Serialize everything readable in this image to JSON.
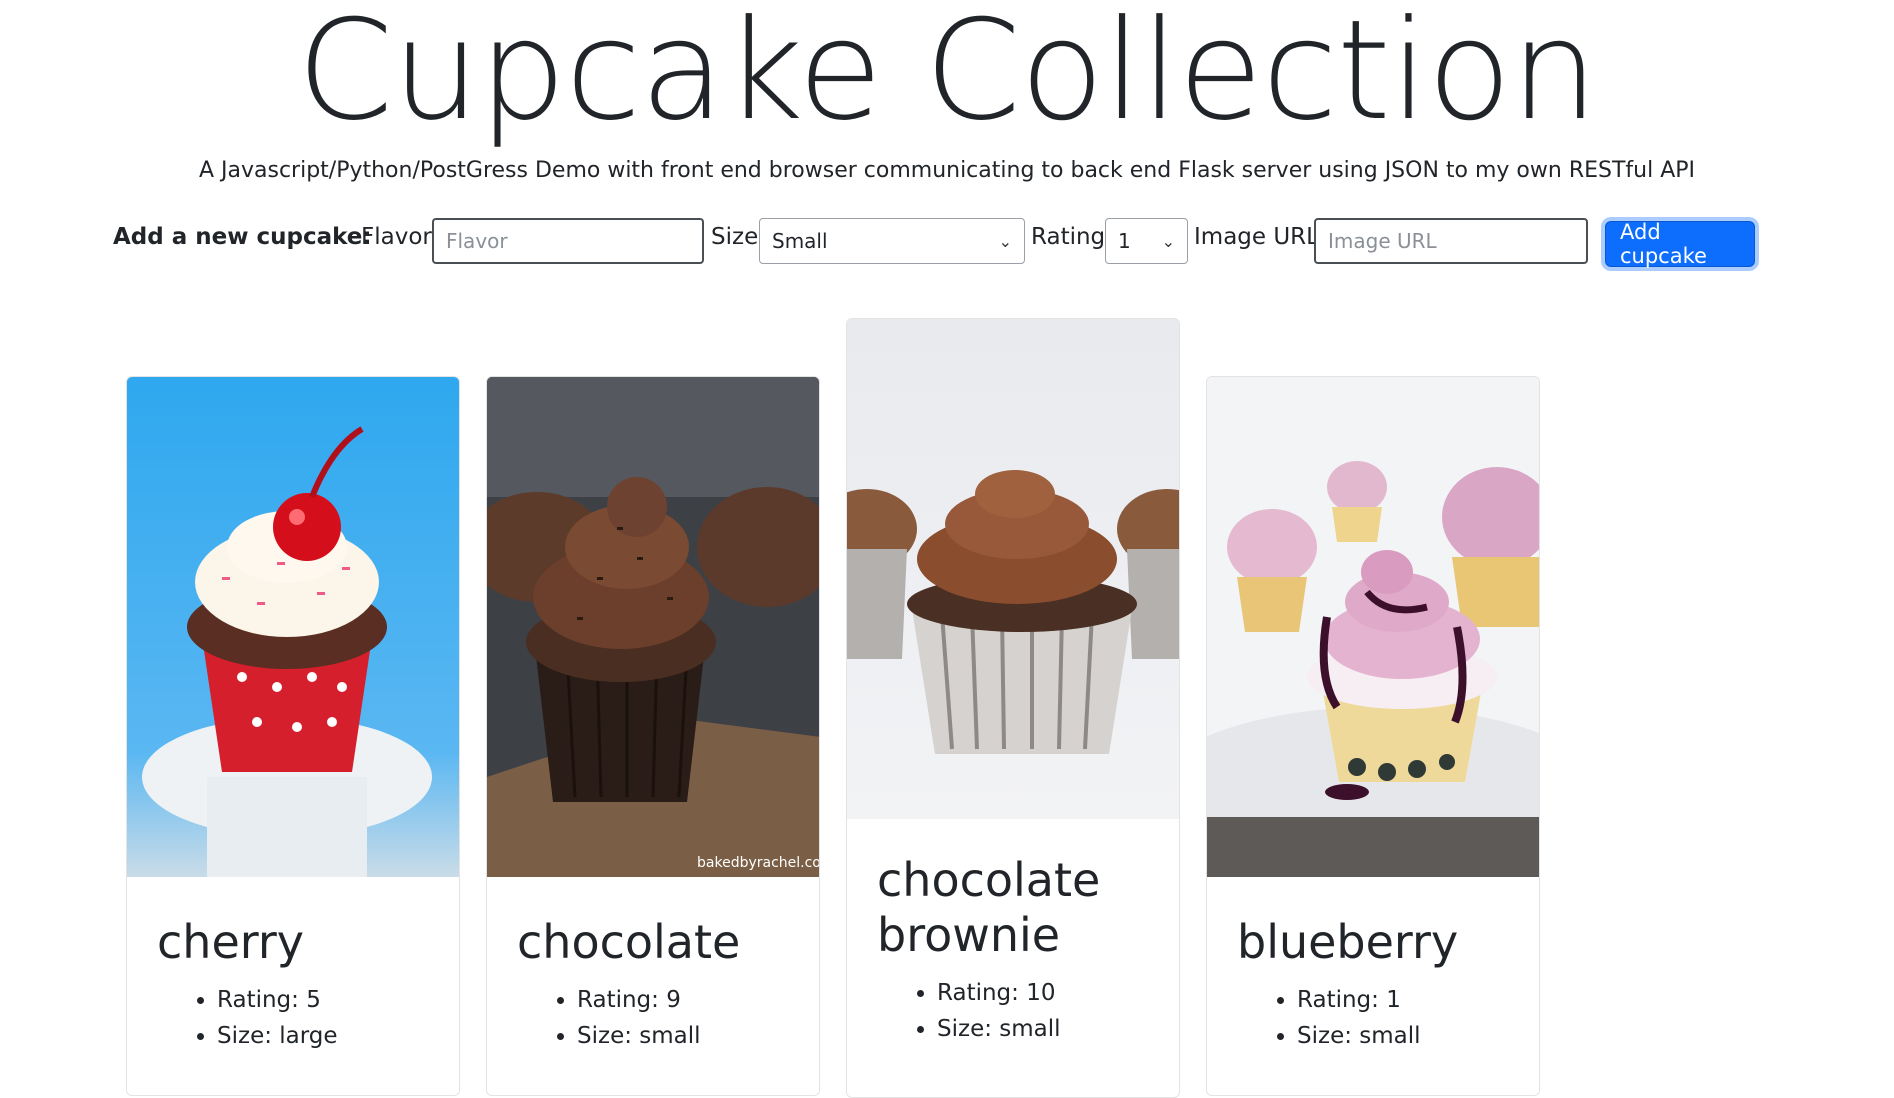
{
  "header": {
    "title": "Cupcake Collection",
    "subtitle": "A Javascript/Python/PostGress Demo with front end browser communicating to back end Flask server using JSON to my own RESTful API"
  },
  "form": {
    "heading": "Add a new cupcake:",
    "flavor_label": "Flavor",
    "flavor_placeholder": "Flavor",
    "size_label": "Size",
    "size_value": "Small",
    "rating_label": "Rating",
    "rating_value": "1",
    "image_label": "Image URL",
    "image_placeholder": "Image URL",
    "submit_label": "Add cupcake"
  },
  "cupcakes": [
    {
      "flavor": "cherry",
      "rating": "Rating: 5",
      "size": "Size: large"
    },
    {
      "flavor": "chocolate",
      "rating": "Rating: 9",
      "size": "Size: small",
      "watermark": "bakedbyrachel.com"
    },
    {
      "flavor": "chocolate brownie",
      "rating": "Rating: 10",
      "size": "Size: small"
    },
    {
      "flavor": "blueberry",
      "rating": "Rating: 1",
      "size": "Size: small"
    }
  ],
  "colors": {
    "primary_button": "#0d6efd",
    "text": "#212529"
  }
}
